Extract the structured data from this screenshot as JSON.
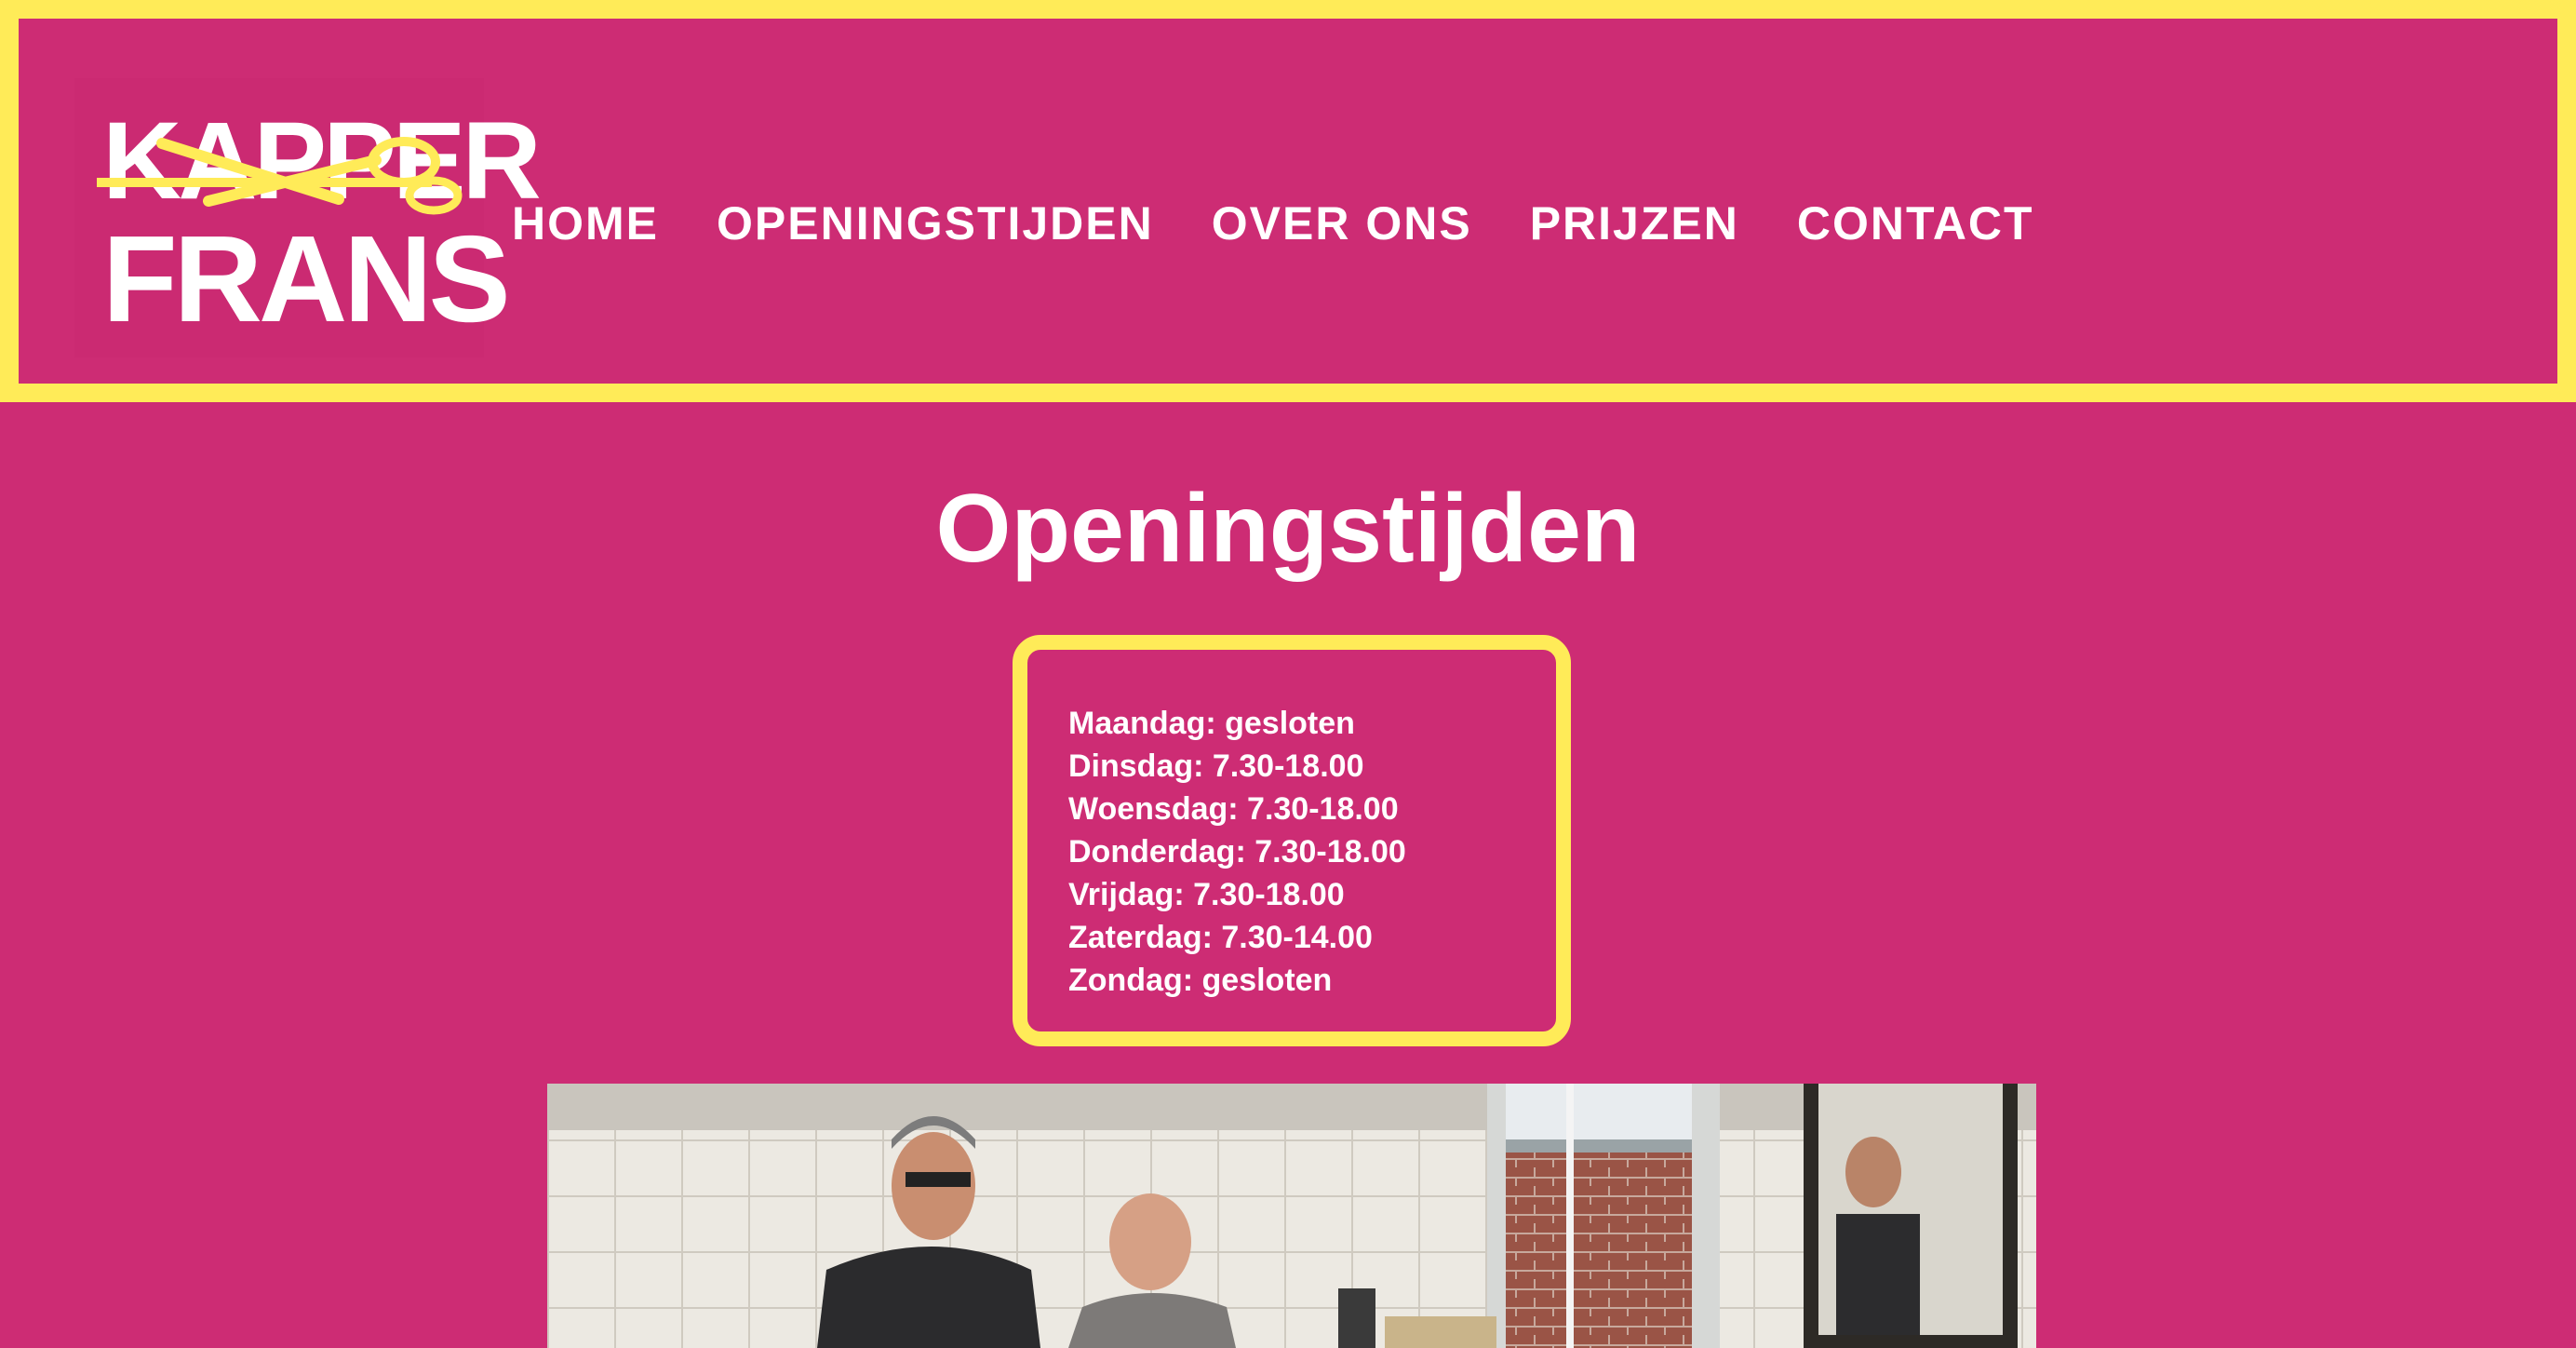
{
  "header": {
    "logo": {
      "line1": "KAPPER",
      "line2": "FRANS",
      "colors": {
        "text": "#ffffff",
        "scissors": "#ffeb58"
      }
    },
    "nav": [
      {
        "label": "HOME"
      },
      {
        "label": "OPENINGSTIJDEN"
      },
      {
        "label": "OVER ONS"
      },
      {
        "label": "PRIJZEN"
      },
      {
        "label": "CONTACT"
      }
    ]
  },
  "main": {
    "title": "Openingstijden",
    "hours": [
      "Maandag: gesloten",
      "Dinsdag: 7.30-18.00",
      "Woensdag: 7.30-18.00",
      "Donderdag: 7.30-18.00",
      "Vrijdag: 7.30-18.00",
      "Zaterdag: 7.30-14.00",
      "Zondag: gesloten"
    ]
  },
  "colors": {
    "brand_pink": "#cd2c74",
    "accent_yellow": "#ffeb58",
    "text": "#ffffff"
  }
}
